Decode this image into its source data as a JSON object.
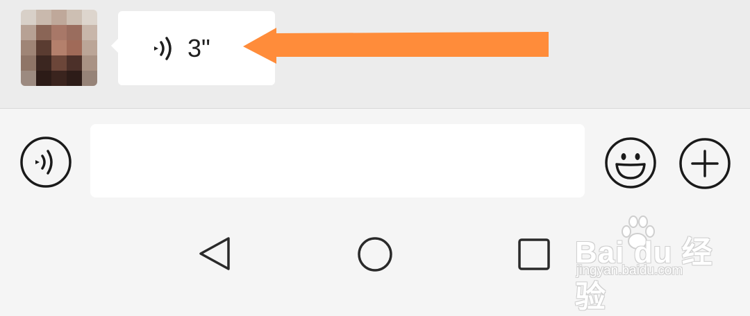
{
  "chat": {
    "avatar_icon": "blurred-avatar",
    "voice_message": {
      "duration": "3\"",
      "icon": "voice-wave-icon"
    },
    "annotation_arrow_color": "#ff8c3a"
  },
  "input_bar": {
    "voice_toggle_icon": "voice-icon",
    "text_value": "",
    "emoji_icon": "emoji-icon",
    "more_icon": "plus-icon"
  },
  "nav_bar": {
    "back_icon": "back-triangle-icon",
    "home_icon": "home-circle-icon",
    "recent_icon": "recent-square-icon"
  },
  "watermark": {
    "logo": "Bai du 经验",
    "url": "jingyan.baidu.com"
  }
}
